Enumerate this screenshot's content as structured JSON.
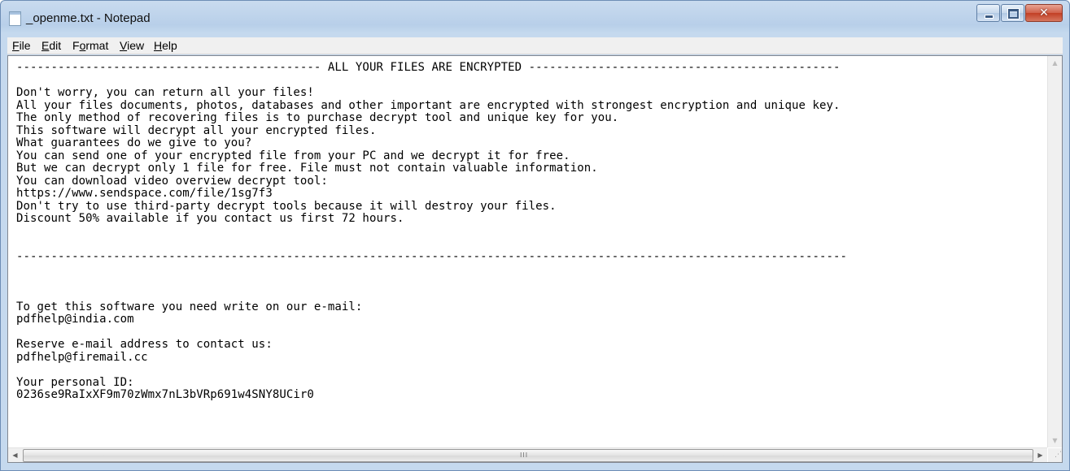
{
  "window": {
    "title": "_openme.txt - Notepad",
    "icon": "notepad-icon",
    "close_glyph": "✕"
  },
  "menu": [
    {
      "label": "File",
      "mnemonic": "F",
      "rest": "ile"
    },
    {
      "label": "Edit",
      "mnemonic": "E",
      "rest": "dit"
    },
    {
      "label": "Format",
      "mnemonic": "o",
      "rest_before": "F",
      "rest_after": "rmat"
    },
    {
      "label": "View",
      "mnemonic": "V",
      "rest": "iew"
    },
    {
      "label": "Help",
      "mnemonic": "H",
      "rest": "elp"
    }
  ],
  "document": {
    "lines": [
      "-------------------------------------------- ALL YOUR FILES ARE ENCRYPTED ---------------------------------------------",
      "",
      "Don't worry, you can return all your files!",
      "All your files documents, photos, databases and other important are encrypted with strongest encryption and unique key.",
      "The only method of recovering files is to purchase decrypt tool and unique key for you.",
      "This software will decrypt all your encrypted files.",
      "What guarantees do we give to you?",
      "You can send one of your encrypted file from your PC and we decrypt it for free.",
      "But we can decrypt only 1 file for free. File must not contain valuable information.",
      "You can download video overview decrypt tool:",
      "https://www.sendspace.com/file/1sg7f3",
      "Don't try to use third-party decrypt tools because it will destroy your files.",
      "Discount 50% available if you contact us first 72 hours.",
      "",
      "",
      "------------------------------------------------------------------------------------------------------------------------",
      "",
      "",
      "",
      "To get this software you need write on our e-mail:",
      "pdfhelp@india.com",
      "",
      "Reserve e-mail address to contact us:",
      "pdfhelp@firemail.cc",
      "",
      "Your personal ID:",
      "0236se9RaIxXF9m70zWmx7nL3bVRp691w4SNY8UCir0"
    ]
  },
  "scrollbars": {
    "up_arrow": "▲",
    "down_arrow": "▼",
    "left_arrow": "◀",
    "right_arrow": "▶",
    "grip": "III",
    "size_grip": "⋰"
  }
}
